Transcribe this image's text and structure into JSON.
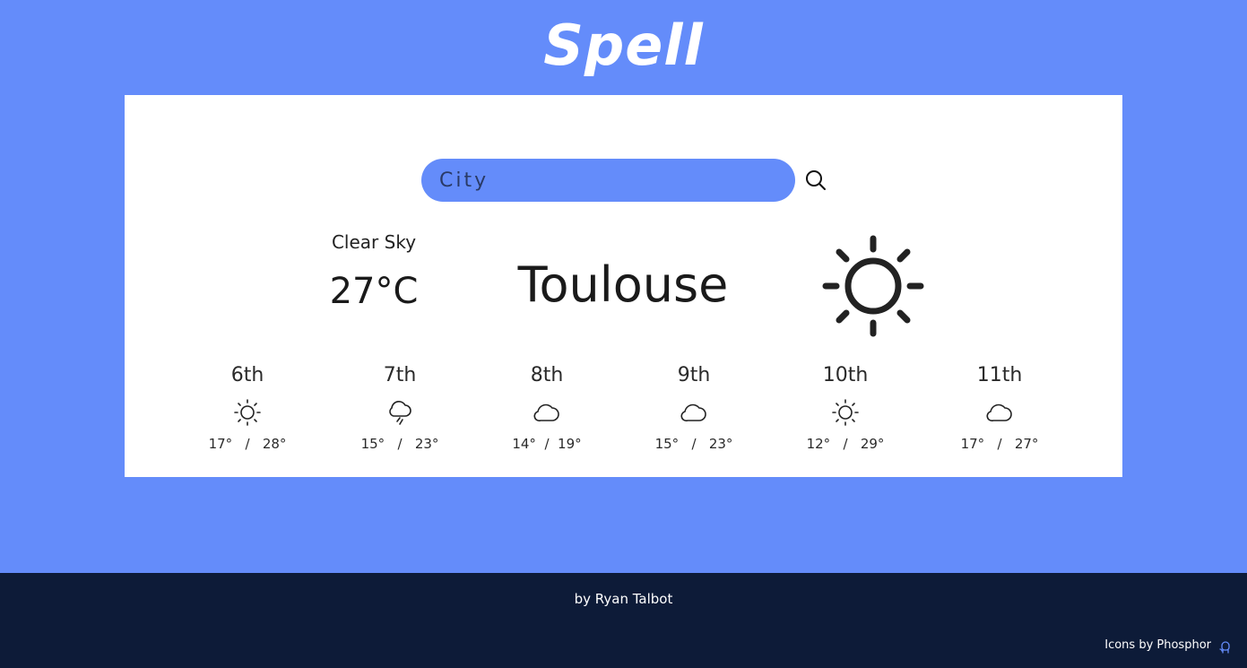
{
  "app": {
    "title": "Spell"
  },
  "search": {
    "placeholder": "City",
    "value": ""
  },
  "current": {
    "description": "Clear Sky",
    "temperature": "27°C",
    "city": "Toulouse",
    "icon": "sun-icon"
  },
  "forecast": [
    {
      "day": "6th",
      "icon": "sun-icon",
      "temps": "17°   /   28°"
    },
    {
      "day": "7th",
      "icon": "cloud-rain-icon",
      "temps": "15°   /   23°"
    },
    {
      "day": "8th",
      "icon": "cloud-icon",
      "temps": "14°  /  19°"
    },
    {
      "day": "9th",
      "icon": "cloud-icon",
      "temps": "15°   /   23°"
    },
    {
      "day": "10th",
      "icon": "sun-icon",
      "temps": "12°   /   29°"
    },
    {
      "day": "11th",
      "icon": "cloud-icon",
      "temps": "17°   /   27°"
    }
  ],
  "footer": {
    "byline": "by Ryan Talbot",
    "credit": "Icons by Phosphor",
    "credit_icon": "github-icon"
  },
  "colors": {
    "background": "#648cfa",
    "card": "#ffffff",
    "footer": "#0d1b38",
    "text": "#1a1a1a"
  }
}
